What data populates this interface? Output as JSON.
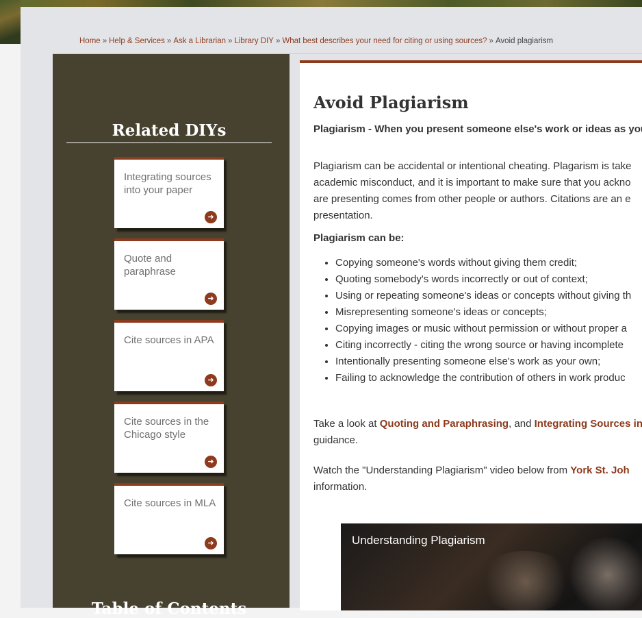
{
  "breadcrumb": {
    "items": [
      "Home",
      "Help & Services",
      "Ask a Librarian",
      "Library DIY",
      "What best describes your need for citing or using sources?"
    ],
    "current": "Avoid plagiarism",
    "separator": "»"
  },
  "sidebar": {
    "title": "Related DIYs",
    "cards": [
      {
        "label": "Integrating sources into your paper"
      },
      {
        "label": "Quote and paraphrase"
      },
      {
        "label": "Cite sources in APA"
      },
      {
        "label": "Cite sources in the Chicago style"
      },
      {
        "label": "Cite sources in MLA"
      }
    ],
    "next_title": "Table of Contents"
  },
  "main": {
    "title": "Avoid Plagiarism",
    "definition": "Plagiarism - When you present someone else's work or ideas as your",
    "intro_lines": [
      "Plagiarism can be accidental or intentional cheating. Plagarism is take",
      "academic misconduct, and it is important to make sure that you ackno",
      "are presenting comes from other people or authors. Citations are an e",
      "presentation."
    ],
    "list_heading": "Plagiarism can be:",
    "list_items": [
      "Copying someone's words without giving them credit;",
      "Quoting somebody's words incorrectly or out of context;",
      "Using or repeating someone's ideas or concepts without giving th",
      "Misrepresenting someone's ideas or concepts;",
      "Copying images or music without permission or without proper a",
      "Citing incorrectly - citing the wrong source or having incomplete",
      "Intentionally presenting someone else's work as your own;",
      "Failing to acknowledge the contribution of others in work produc"
    ],
    "take_look": {
      "prefix": "Take a look at ",
      "link1": "Quoting and Paraphrasing",
      "middle": ", and ",
      "link2": "Integrating Sources int",
      "line2": "guidance."
    },
    "watch": {
      "prefix": "Watch the \"Understanding Plagiarism\" video below from ",
      "link": "York St. Joh",
      "line2": "information."
    },
    "video_title": "Understanding Plagiarism"
  },
  "colors": {
    "accent": "#8d3a1d",
    "sidebar_bg": "#47422f",
    "page_bg": "#e3e4e8"
  },
  "icons": {
    "card_arrow": "arrow-circle-right-icon"
  }
}
